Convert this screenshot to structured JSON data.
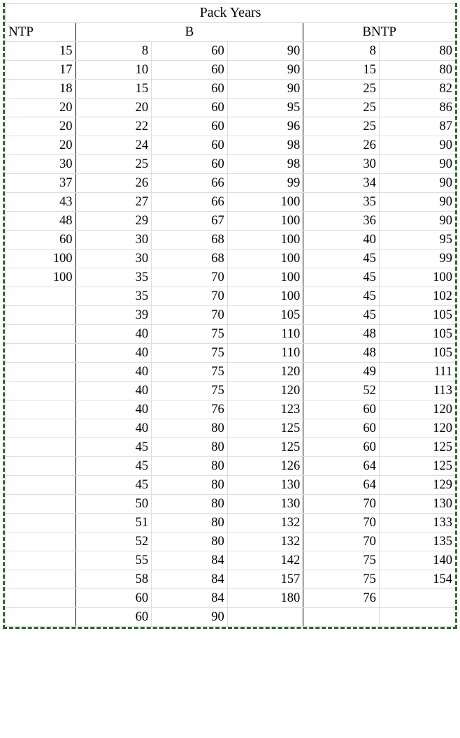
{
  "title": "Pack Years",
  "headers": {
    "ntp": "NTP",
    "b": "B",
    "bntp": "BNTP"
  },
  "chart_data": {
    "type": "table",
    "title": "Pack Years",
    "columns": [
      "NTP",
      "B_col1",
      "B_col2",
      "B_col3",
      "BNTP_col1",
      "BNTP_col2"
    ],
    "rows": [
      [
        15,
        8,
        60,
        90,
        8,
        80
      ],
      [
        17,
        10,
        60,
        90,
        15,
        80
      ],
      [
        18,
        15,
        60,
        90,
        25,
        82
      ],
      [
        20,
        20,
        60,
        95,
        25,
        86
      ],
      [
        20,
        22,
        60,
        96,
        25,
        87
      ],
      [
        20,
        24,
        60,
        98,
        26,
        90
      ],
      [
        30,
        25,
        60,
        98,
        30,
        90
      ],
      [
        37,
        26,
        66,
        99,
        34,
        90
      ],
      [
        43,
        27,
        66,
        100,
        35,
        90
      ],
      [
        48,
        29,
        67,
        100,
        36,
        90
      ],
      [
        60,
        30,
        68,
        100,
        40,
        95
      ],
      [
        100,
        30,
        68,
        100,
        45,
        99
      ],
      [
        100,
        35,
        70,
        100,
        45,
        100
      ],
      [
        null,
        35,
        70,
        100,
        45,
        102
      ],
      [
        null,
        39,
        70,
        105,
        45,
        105
      ],
      [
        null,
        40,
        75,
        110,
        48,
        105
      ],
      [
        null,
        40,
        75,
        110,
        48,
        105
      ],
      [
        null,
        40,
        75,
        120,
        49,
        111
      ],
      [
        null,
        40,
        75,
        120,
        52,
        113
      ],
      [
        null,
        40,
        76,
        123,
        60,
        120
      ],
      [
        null,
        40,
        80,
        125,
        60,
        120
      ],
      [
        null,
        45,
        80,
        125,
        60,
        125
      ],
      [
        null,
        45,
        80,
        126,
        64,
        125
      ],
      [
        null,
        45,
        80,
        130,
        64,
        129
      ],
      [
        null,
        50,
        80,
        130,
        70,
        130
      ],
      [
        null,
        51,
        80,
        132,
        70,
        133
      ],
      [
        null,
        52,
        80,
        132,
        70,
        135
      ],
      [
        null,
        55,
        84,
        142,
        75,
        140
      ],
      [
        null,
        58,
        84,
        157,
        75,
        154
      ],
      [
        null,
        60,
        84,
        180,
        76,
        null
      ],
      [
        null,
        60,
        90,
        null,
        null,
        null
      ]
    ]
  }
}
